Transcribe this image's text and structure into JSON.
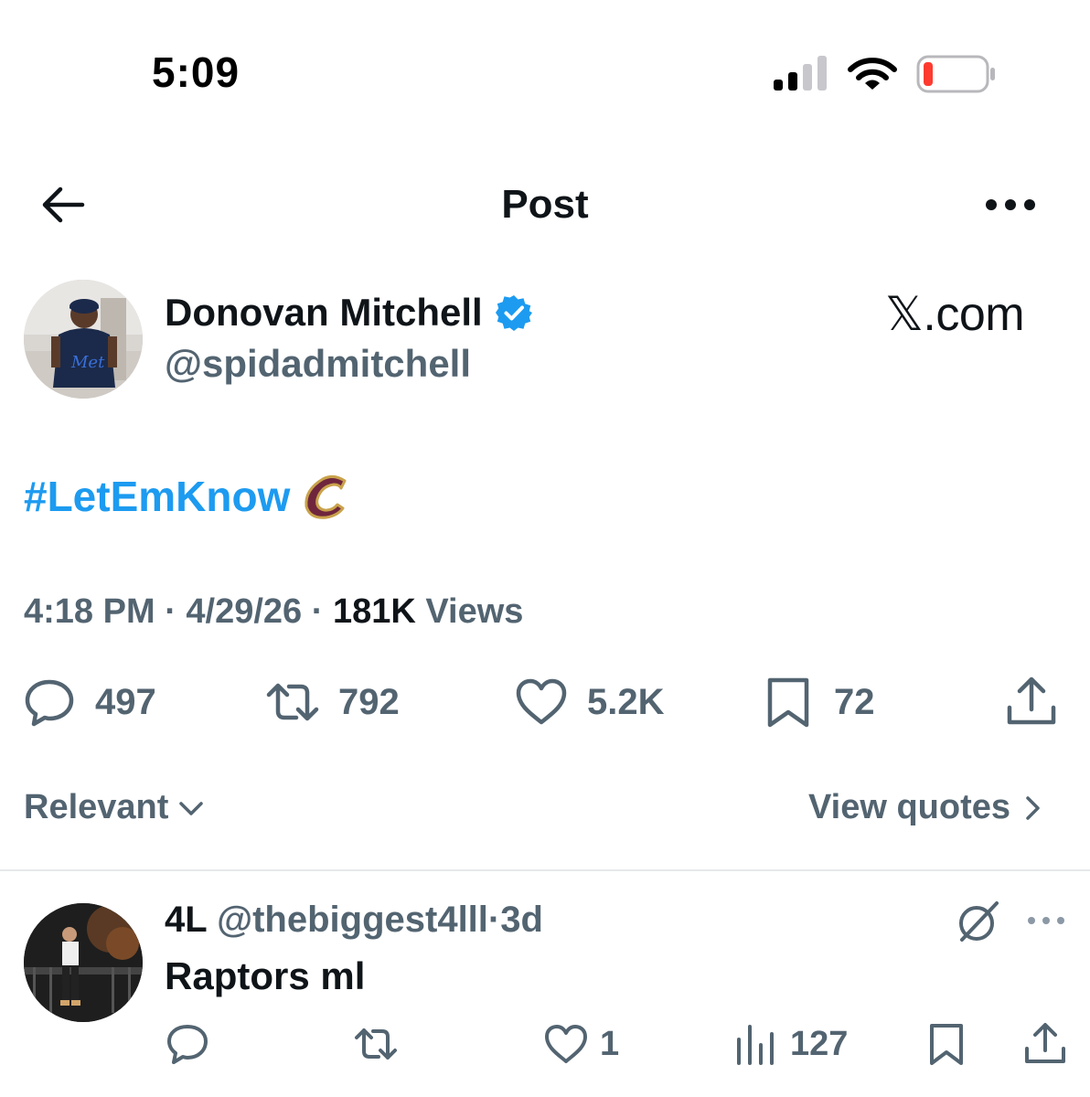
{
  "status_bar": {
    "time": "5:09"
  },
  "header": {
    "title": "Post",
    "back_icon": "arrow-left-icon",
    "more_icon": "more-horizontal-icon"
  },
  "post": {
    "author_name": "Donovan Mitchell",
    "author_handle": "@spidadmitchell",
    "watermark": "𝕏.com",
    "hashtag": "#LetEmKnow",
    "time": "4:18 PM",
    "date": "4/29/26",
    "views_count": "181K",
    "views_label": "Views",
    "sep": "·",
    "stats": {
      "replies": "497",
      "reposts": "792",
      "likes": "5.2K",
      "bookmarks": "72"
    }
  },
  "sort": {
    "label": "Relevant",
    "view_quotes": "View quotes"
  },
  "reply": {
    "name": "4L",
    "handle": "@thebiggest4lll",
    "age": "3d",
    "sep": "·",
    "text": "Raptors ml",
    "stats": {
      "likes": "1",
      "views": "127"
    }
  },
  "colors": {
    "accent": "#1d9bf0",
    "secondary_text": "#536471",
    "primary_text": "#0f1419",
    "battery_low": "#ff3b30"
  }
}
